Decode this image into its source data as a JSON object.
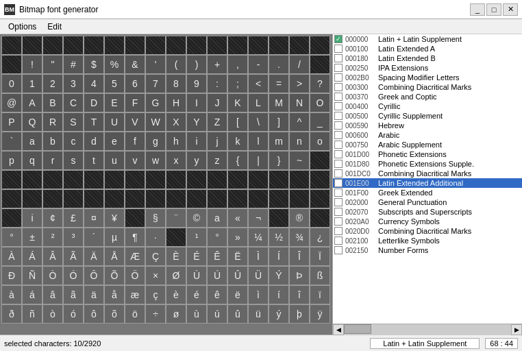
{
  "titleBar": {
    "icon": "BM",
    "title": "Bitmap font generator",
    "minimizeLabel": "_",
    "maximizeLabel": "□",
    "closeLabel": "✕"
  },
  "menuBar": {
    "items": [
      "Options",
      "Edit"
    ]
  },
  "charGrid": {
    "rows": [
      [
        "",
        "",
        "",
        "",
        "",
        "",
        "",
        "",
        "",
        "",
        "",
        "",
        "",
        "",
        "",
        ""
      ],
      [
        "",
        "!",
        "\"",
        "#",
        "$",
        "%",
        "&",
        "'",
        "(",
        ")",
        "+",
        ",",
        "-",
        ".",
        "/",
        ""
      ],
      [
        "0",
        "1",
        "2",
        "3",
        "4",
        "5",
        "6",
        "7",
        "8",
        "9",
        ":",
        ";",
        "<",
        "=",
        ">",
        "?"
      ],
      [
        "@",
        "A",
        "B",
        "C",
        "D",
        "E",
        "F",
        "G",
        "H",
        "I",
        "J",
        "K",
        "L",
        "M",
        "N",
        "O"
      ],
      [
        "P",
        "Q",
        "R",
        "S",
        "T",
        "U",
        "V",
        "W",
        "X",
        "Y",
        "Z",
        "[",
        "\\",
        "]",
        "^",
        "_"
      ],
      [
        "`",
        "a",
        "b",
        "c",
        "d",
        "e",
        "f",
        "g",
        "h",
        "i",
        "j",
        "k",
        "l",
        "m",
        "n",
        "o"
      ],
      [
        "p",
        "q",
        "r",
        "s",
        "t",
        "u",
        "v",
        "w",
        "x",
        "y",
        "z",
        "{",
        "|",
        "}",
        "~",
        ""
      ],
      [
        "",
        "",
        "",
        "",
        "",
        "",
        "",
        "",
        "",
        "",
        "",
        "",
        "",
        "",
        "",
        ""
      ],
      [
        "",
        "",
        "",
        "",
        "",
        "",
        "",
        "",
        "",
        "",
        "",
        "",
        "",
        "",
        "",
        ""
      ],
      [
        "",
        "i",
        "¢",
        "£",
        "¤",
        "¥",
        "",
        "§",
        "¨",
        "©",
        "a",
        "«",
        "¬",
        "",
        "®",
        ""
      ],
      [
        "°",
        "±",
        "²",
        "³",
        "´",
        "µ",
        "¶",
        "·",
        "",
        "¹",
        "°",
        "»",
        "¼",
        "½",
        "¾",
        "¿"
      ],
      [
        "À",
        "Á",
        "Â",
        "Ã",
        "Ä",
        "Å",
        "Æ",
        "Ç",
        "È",
        "É",
        "Ê",
        "Ë",
        "Ì",
        "Í",
        "Î",
        "Ï"
      ],
      [
        "Ð",
        "Ñ",
        "Ò",
        "Ó",
        "Ô",
        "Õ",
        "Ö",
        "×",
        "Ø",
        "Ù",
        "Ú",
        "Û",
        "Ü",
        "Ý",
        "Þ",
        "ß"
      ],
      [
        "à",
        "á",
        "â",
        "ã",
        "ä",
        "å",
        "æ",
        "ç",
        "è",
        "é",
        "ê",
        "ë",
        "ì",
        "í",
        "î",
        "ï"
      ],
      [
        "ð",
        "ñ",
        "ò",
        "ó",
        "ô",
        "õ",
        "ö",
        "÷",
        "ø",
        "ù",
        "ú",
        "û",
        "ü",
        "ý",
        "þ",
        "ÿ"
      ]
    ],
    "cellTypes": {
      "filled": "dark hatched background",
      "visible": "grey background with character",
      "selected": "blue selected"
    }
  },
  "sidebar": {
    "items": [
      {
        "checked": true,
        "greenCheck": true,
        "code": "000000",
        "name": "Latin + Latin Supplement"
      },
      {
        "checked": false,
        "code": "000100",
        "name": "Latin Extended A"
      },
      {
        "checked": false,
        "code": "000180",
        "name": "Latin Extended B"
      },
      {
        "checked": false,
        "code": "000250",
        "name": "IPA Extensions"
      },
      {
        "checked": false,
        "code": "0002B0",
        "name": "Spacing Modifier Letters"
      },
      {
        "checked": false,
        "code": "000300",
        "name": "Combining Diacritical Marks"
      },
      {
        "checked": false,
        "code": "000370",
        "name": "Greek and Coptic"
      },
      {
        "checked": false,
        "code": "000400",
        "name": "Cyrillic"
      },
      {
        "checked": false,
        "code": "000500",
        "name": "Cyrillic Supplement"
      },
      {
        "checked": false,
        "code": "000590",
        "name": "Hebrew"
      },
      {
        "checked": false,
        "code": "000600",
        "name": "Arabic"
      },
      {
        "checked": false,
        "code": "000750",
        "name": "Arabic Supplement"
      },
      {
        "checked": false,
        "code": "001D00",
        "name": "Phonetic Extensions"
      },
      {
        "checked": false,
        "code": "001D80",
        "name": "Phonetic Extensions Supple."
      },
      {
        "checked": false,
        "code": "001DC0",
        "name": "Combining Diacritical Marks"
      },
      {
        "checked": false,
        "code": "001E00",
        "name": "Latin Extended Additional",
        "selected": true
      },
      {
        "checked": false,
        "code": "001F00",
        "name": "Greek Extended"
      },
      {
        "checked": false,
        "code": "002000",
        "name": "General Punctuation"
      },
      {
        "checked": false,
        "code": "002070",
        "name": "Subscripts and Superscripts"
      },
      {
        "checked": false,
        "code": "0020A0",
        "name": "Currency Symbols"
      },
      {
        "checked": false,
        "code": "0020D0",
        "name": "Combining Diacritical Marks"
      },
      {
        "checked": false,
        "code": "002100",
        "name": "Letterlike Symbols"
      },
      {
        "checked": false,
        "code": "002150",
        "name": "Number Forms"
      }
    ]
  },
  "statusBar": {
    "selectedChars": "selected characters: 10/2920",
    "currentBlock": "Latin + Latin Supplement",
    "coordinates": "68 : 44"
  }
}
